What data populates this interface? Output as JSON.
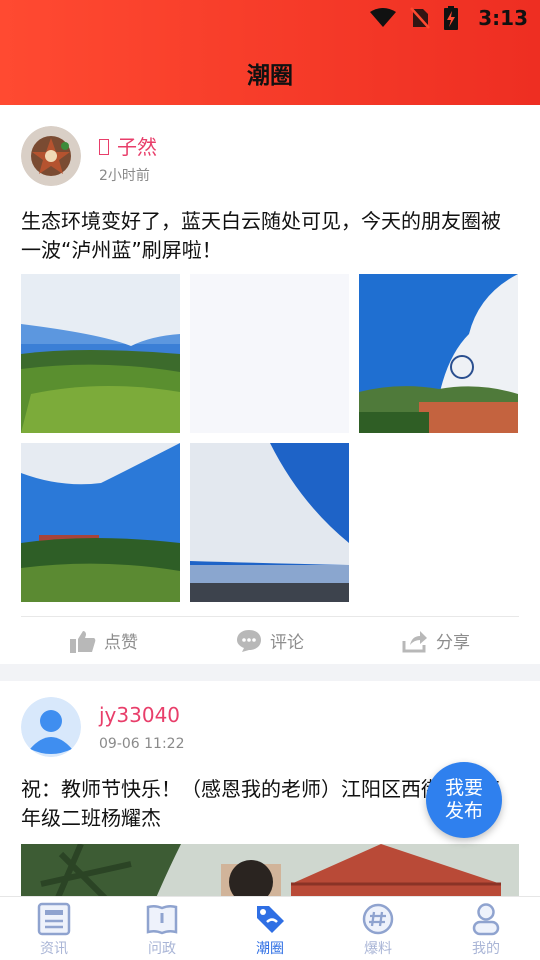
{
  "status_bar": {
    "time": "3:13"
  },
  "header": {
    "title": "潮圈"
  },
  "posts": [
    {
      "badge": "",
      "username": "子然",
      "time": "2小时前",
      "content": "生态环境变好了，蓝天白云随处可见，今天的朋友圈被一波“泸州蓝”刷屏啦！",
      "actions": {
        "like": "点赞",
        "comment": "评论",
        "share": "分享"
      }
    },
    {
      "username": "jy33040",
      "time": "09-06 11:22",
      "content": "祝：教师节快乐！（感恩我的老师）江阳区西街小学三年级二班杨耀杰"
    }
  ],
  "fab": {
    "line1": "我要",
    "line2": "发布"
  },
  "tabbar": {
    "items": [
      {
        "label": "资讯",
        "icon": "news-icon"
      },
      {
        "label": "问政",
        "icon": "book-icon"
      },
      {
        "label": "潮圈",
        "icon": "tag-icon",
        "active": true
      },
      {
        "label": "爆料",
        "icon": "hashtag-icon"
      },
      {
        "label": "我的",
        "icon": "person-icon"
      }
    ]
  },
  "colors": {
    "header": "#f2402b",
    "username": "#e83e6a",
    "accent": "#2f80ee",
    "tab_inactive": "#a9b5d6"
  }
}
